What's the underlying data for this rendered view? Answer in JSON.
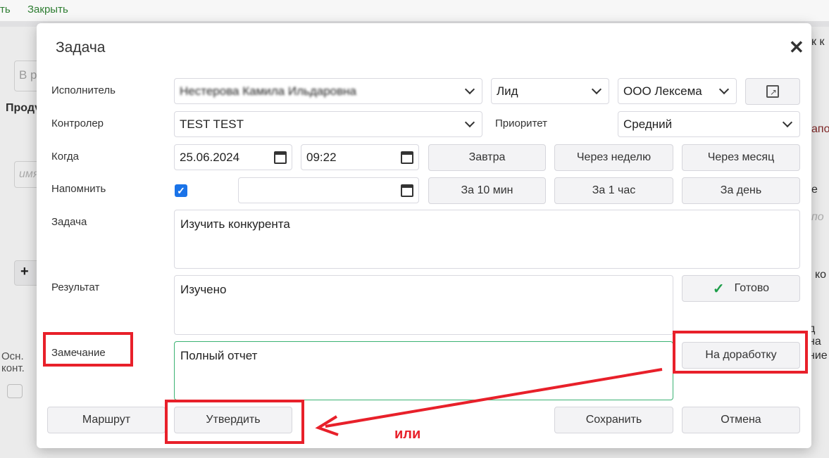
{
  "background": {
    "top_left": "ть",
    "close_link": "Закрыть",
    "field_placeholder": "В р",
    "tab": "Продү",
    "name_placeholder": "имя",
    "col_header": "Осн. конт.",
    "right_1": "к к",
    "right_2": "апо",
    "right_3": "е",
    "right_4": "по",
    "right_5": "ко",
    "right_6": "д на",
    "right_7": "ние"
  },
  "dialog": {
    "title": "Задача",
    "labels": {
      "executor": "Исполнитель",
      "controller": "Контролер",
      "when": "Когда",
      "remind": "Напомнить",
      "task": "Задача",
      "result": "Результат",
      "remark": "Замечание",
      "priority": "Приоритет"
    },
    "executor": "Нестерова Камила Ильдаровна",
    "role": "Лид",
    "company": "ООО Лексема",
    "controller": "TEST TEST",
    "priority": "Средний",
    "date": "25.06.2024",
    "time": "09:22",
    "remind_checked": true,
    "remind_date": "",
    "quick_when": [
      "Завтра",
      "Через неделю",
      "Через месяц"
    ],
    "quick_remind": [
      "За 10 мин",
      "За 1 час",
      "За день"
    ],
    "task_text": "Изучить конкурента",
    "result_text": "Изучено",
    "remark_text": "Полный отчет",
    "done_button": "Готово",
    "rework_button": "На доработку",
    "route_button": "Маршрут",
    "approve_button": "Утвердить",
    "save_button": "Сохранить",
    "cancel_button": "Отмена"
  },
  "annotation": {
    "or_text": "или",
    "color": "#e8202a"
  }
}
